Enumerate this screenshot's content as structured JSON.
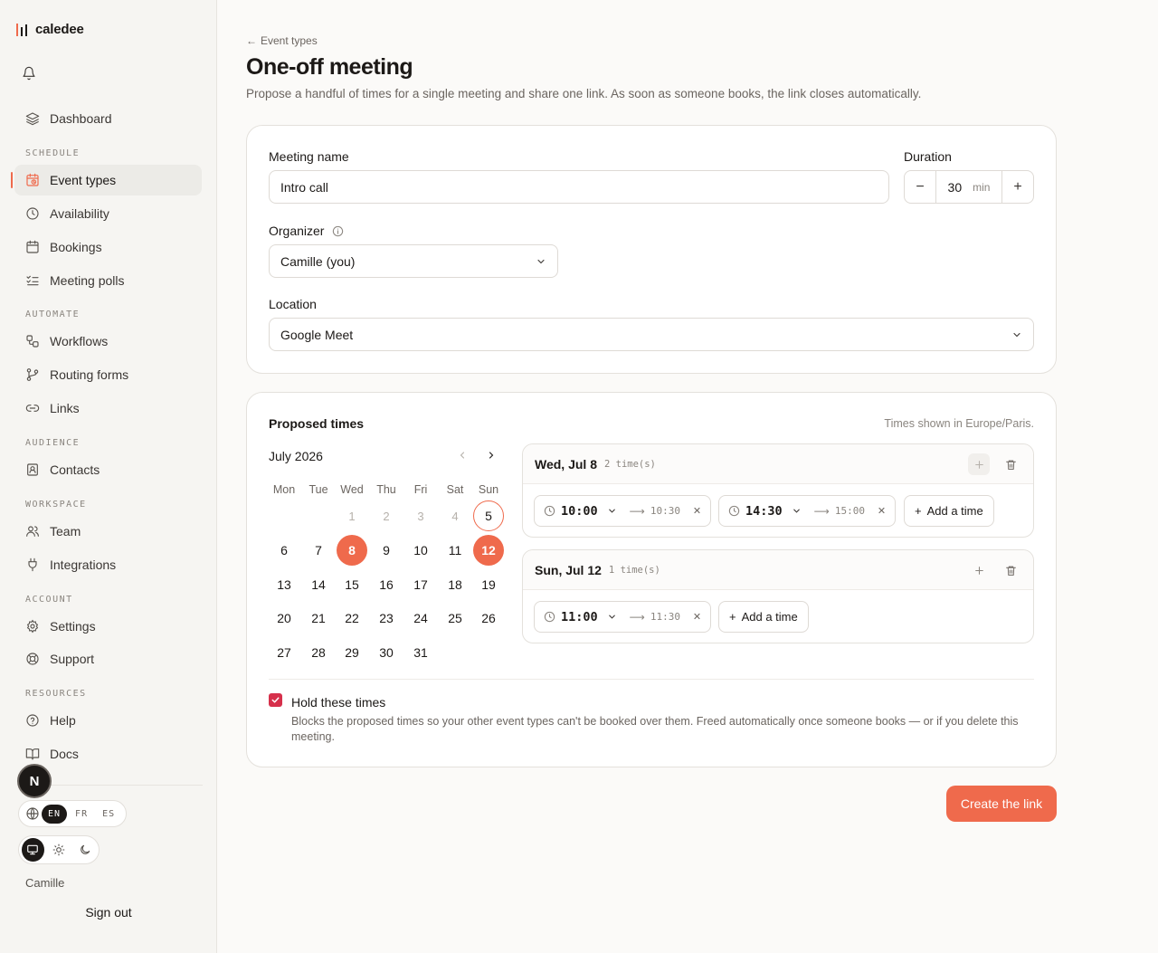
{
  "app": {
    "brand": "caledee"
  },
  "sidebar": {
    "items": {
      "dashboard": "Dashboard",
      "event_types": "Event types",
      "availability": "Availability",
      "bookings": "Bookings",
      "meeting_polls": "Meeting polls",
      "workflows": "Workflows",
      "routing_forms": "Routing forms",
      "links": "Links",
      "contacts": "Contacts",
      "team": "Team",
      "integrations": "Integrations",
      "settings": "Settings",
      "support": "Support",
      "help": "Help",
      "docs": "Docs"
    },
    "sections": {
      "schedule": "SCHEDULE",
      "automate": "AUTOMATE",
      "audience": "AUDIENCE",
      "workspace": "WORKSPACE",
      "account": "ACCOUNT",
      "resources": "RESOURCES"
    },
    "avatar_letter": "N",
    "languages": [
      "EN",
      "FR",
      "ES"
    ],
    "active_language": "EN",
    "user_name": "Camille",
    "sign_out": "Sign out"
  },
  "page": {
    "back_label": "Event types",
    "title": "One-off meeting",
    "description": "Propose a handful of times for a single meeting and share one link. As soon as someone books, the link closes automatically."
  },
  "form": {
    "meeting_name_label": "Meeting name",
    "meeting_name_value": "Intro call",
    "duration_label": "Duration",
    "duration_value": "30",
    "duration_unit": "min",
    "organizer_label": "Organizer",
    "organizer_value": "Camille (you)",
    "location_label": "Location",
    "location_value": "Google Meet"
  },
  "proposed": {
    "title": "Proposed times",
    "timezone_note": "Times shown in Europe/Paris.",
    "month_label": "July 2026",
    "weekdays": [
      "Mon",
      "Tue",
      "Wed",
      "Thu",
      "Fri",
      "Sat",
      "Sun"
    ],
    "days": {
      "d1": "1",
      "d2": "2",
      "d3": "3",
      "d4": "4",
      "d5": "5",
      "d6": "6",
      "d7": "7",
      "d8": "8",
      "d9": "9",
      "d10": "10",
      "d11": "11",
      "d12": "12",
      "d13": "13",
      "d14": "14",
      "d15": "15",
      "d16": "16",
      "d17": "17",
      "d18": "18",
      "d19": "19",
      "d20": "20",
      "d21": "21",
      "d22": "22",
      "d23": "23",
      "d24": "24",
      "d25": "25",
      "d26": "26",
      "d27": "27",
      "d28": "28",
      "d29": "29",
      "d30": "30",
      "d31": "31"
    },
    "selected_days": [
      "8",
      "12"
    ],
    "today": "5",
    "day_panels": [
      {
        "title": "Wed, Jul 8",
        "count": "2 time(s)",
        "slots": [
          {
            "start": "10:00",
            "end": "10:30"
          },
          {
            "start": "14:30",
            "end": "15:00"
          }
        ],
        "add_label": "Add a time"
      },
      {
        "title": "Sun, Jul 12",
        "count": "1 time(s)",
        "slots": [
          {
            "start": "11:00",
            "end": "11:30"
          }
        ],
        "add_label": "Add a time"
      }
    ],
    "hold": {
      "checked": true,
      "title": "Hold these times",
      "description": "Blocks the proposed times so your other event types can't be booked over them. Freed automatically once someone books — or if you delete this meeting."
    }
  },
  "actions": {
    "create_label": "Create the link"
  },
  "colors": {
    "accent": "#ef6a4c",
    "checkbox": "#d6304b",
    "text": "#1c1917"
  }
}
